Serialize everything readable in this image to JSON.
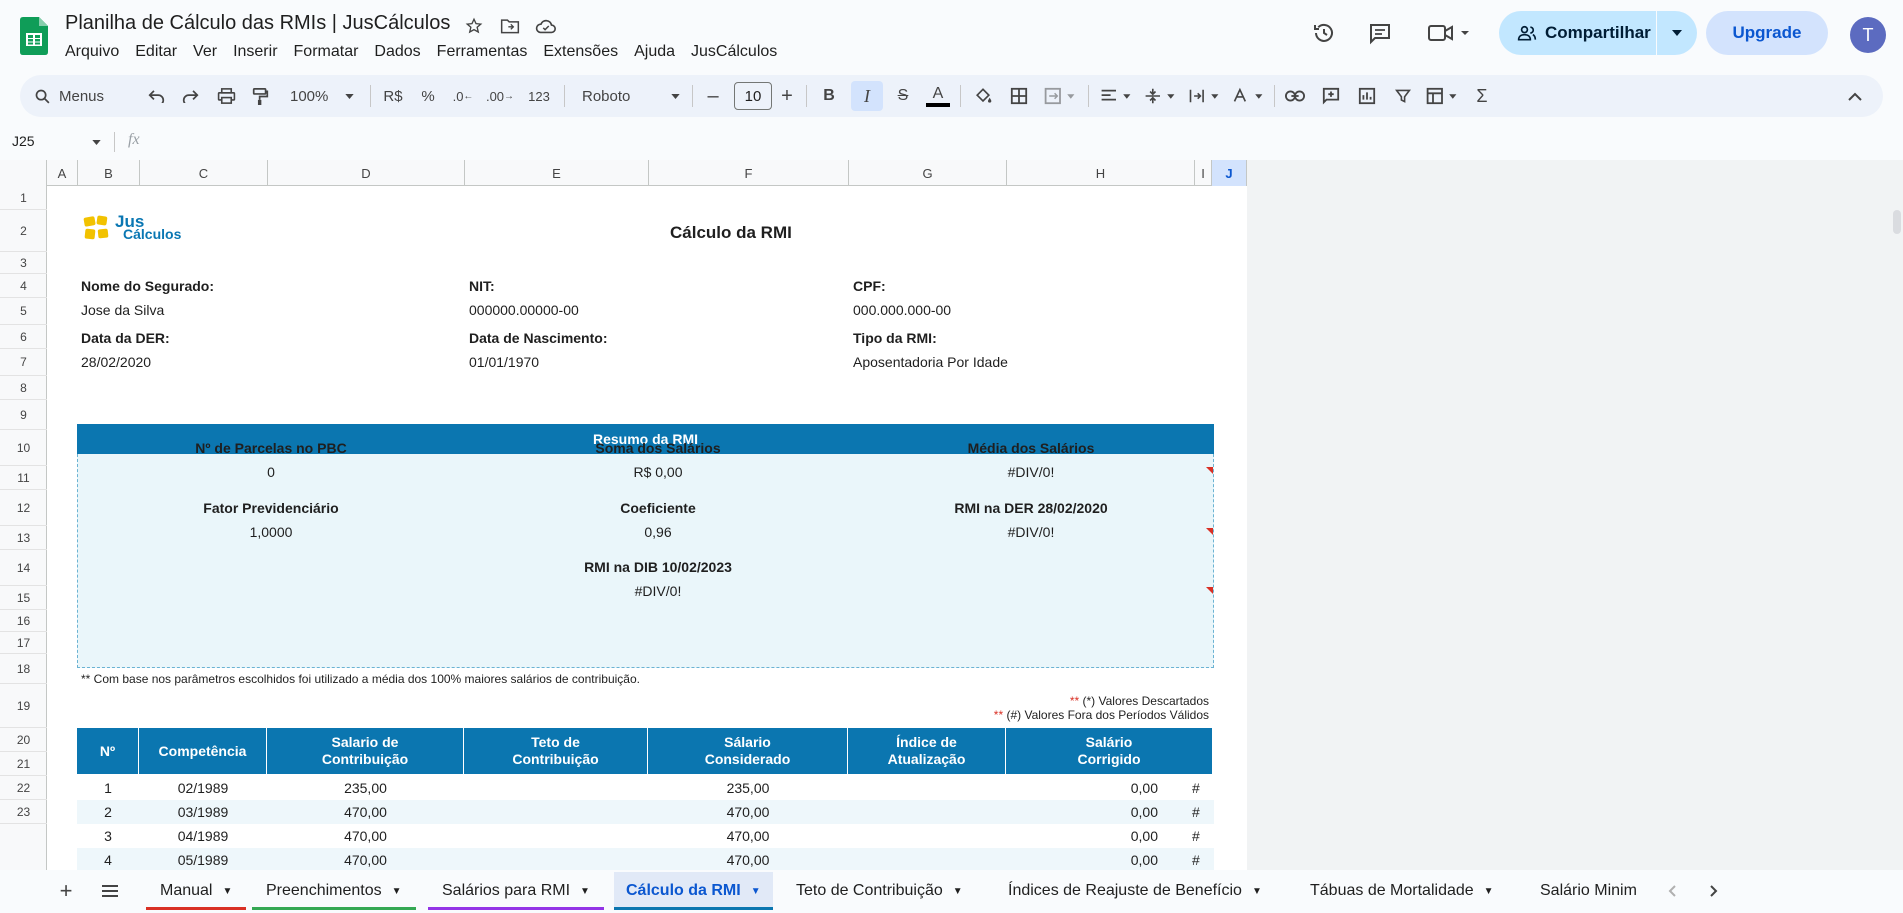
{
  "app": {
    "title": "Planilha de Cálculo das RMIs | JusCálculos",
    "menus": [
      "Arquivo",
      "Editar",
      "Ver",
      "Inserir",
      "Formatar",
      "Dados",
      "Ferramentas",
      "Extensões",
      "Ajuda",
      "JusCálculos"
    ],
    "share_label": "Compartilhar",
    "upgrade_label": "Upgrade",
    "avatar_initial": "T"
  },
  "toolbar": {
    "search_label": "Menus",
    "zoom": "100%",
    "currency": "R$",
    "percent": "%",
    "dec_decrease": ".0",
    "dec_increase": ".00",
    "number_format": "123",
    "font": "Roboto",
    "font_size": "10"
  },
  "formula_bar": {
    "cell_ref": "J25",
    "fx": "fx"
  },
  "columns": [
    "A",
    "B",
    "C",
    "D",
    "E",
    "F",
    "G",
    "H",
    "I",
    "J"
  ],
  "rows": [
    "1",
    "2",
    "3",
    "4",
    "5",
    "6",
    "7",
    "8",
    "9",
    "10",
    "11",
    "12",
    "13",
    "14",
    "15",
    "16",
    "17",
    "18",
    "19",
    "20",
    "21",
    "22",
    "23"
  ],
  "sheet": {
    "logo_top": "Jus",
    "logo_bottom": "Cálculos",
    "title": "Cálculo da RMI",
    "fields": {
      "nome_label": "Nome do Segurado:",
      "nome_value": "Jose da Silva",
      "nit_label": "NIT:",
      "nit_value": "000000.00000-00",
      "cpf_label": "CPF:",
      "cpf_value": "000.000.000-00",
      "der_label": "Data da DER:",
      "der_value": "28/02/2020",
      "nasc_label": "Data de Nascimento:",
      "nasc_value": "01/01/1970",
      "tipo_label": "Tipo da RMI:",
      "tipo_value": "Aposentadoria Por Idade"
    },
    "resumo": {
      "header": "Resumo da RMI",
      "parcelas_label": "Nº de Parcelas no PBC",
      "parcelas_value": "0",
      "soma_label": "Soma dos Salários",
      "soma_value": "R$ 0,00",
      "media_label": "Média dos Salários",
      "media_value": "#DIV/0!",
      "fator_label": "Fator Previdenciário",
      "fator_value": "1,0000",
      "coef_label": "Coeficiente",
      "coef_value": "0,96",
      "rmi_der_label": "RMI na DER 28/02/2020",
      "rmi_der_value": "#DIV/0!",
      "rmi_dib_label": "RMI na DIB 10/02/2023",
      "rmi_dib_value": "#DIV/0!"
    },
    "note_base": "** Com base nos parâmetros escolhidos foi utilizado a média dos 100% maiores salários de contribuição.",
    "legend_star": "**",
    "legend_descartados": " (*) Valores Descartados",
    "legend_fora": " (#) Valores Fora dos Períodos Válidos",
    "table": {
      "headers": {
        "n": "Nº",
        "competencia": "Competência",
        "sal_contrib_1": "Salario de",
        "sal_contrib_2": "Contribuição",
        "teto_1": "Teto de",
        "teto_2": "Contribuição",
        "sal_cons_1": "Sálario",
        "sal_cons_2": "Considerado",
        "indice_1": "Índice de",
        "indice_2": "Atualização",
        "sal_corr_1": "Salário",
        "sal_corr_2": "Corrigido"
      },
      "rows": [
        {
          "n": "1",
          "comp": "02/1989",
          "sal": "235,00",
          "teto": "",
          "cons": "235,00",
          "ind": "",
          "corr": "0,00",
          "flag": "#"
        },
        {
          "n": "2",
          "comp": "03/1989",
          "sal": "470,00",
          "teto": "",
          "cons": "470,00",
          "ind": "",
          "corr": "0,00",
          "flag": "#"
        },
        {
          "n": "3",
          "comp": "04/1989",
          "sal": "470,00",
          "teto": "",
          "cons": "470,00",
          "ind": "",
          "corr": "0,00",
          "flag": "#"
        },
        {
          "n": "4",
          "comp": "05/1989",
          "sal": "470,00",
          "teto": "",
          "cons": "470,00",
          "ind": "",
          "corr": "0,00",
          "flag": "#"
        }
      ]
    }
  },
  "tabs": [
    {
      "label": "Manual",
      "color": "#d93025"
    },
    {
      "label": "Preenchimentos",
      "color": "#34a853"
    },
    {
      "label": "Salários para RMI",
      "color": "#9334e6"
    },
    {
      "label": "Cálculo da RMI",
      "color": "#0b76b0",
      "active": true
    },
    {
      "label": "Teto de Contribuição",
      "color": ""
    },
    {
      "label": "Índices de Reajuste de Benefício",
      "color": ""
    },
    {
      "label": "Tábuas de Mortalidade",
      "color": ""
    },
    {
      "label": "Salário Minim",
      "color": ""
    }
  ],
  "colors": {
    "accent": "#0b76b0",
    "share_bg": "#c2e7ff",
    "upgrade_bg": "#d3e3fd"
  }
}
